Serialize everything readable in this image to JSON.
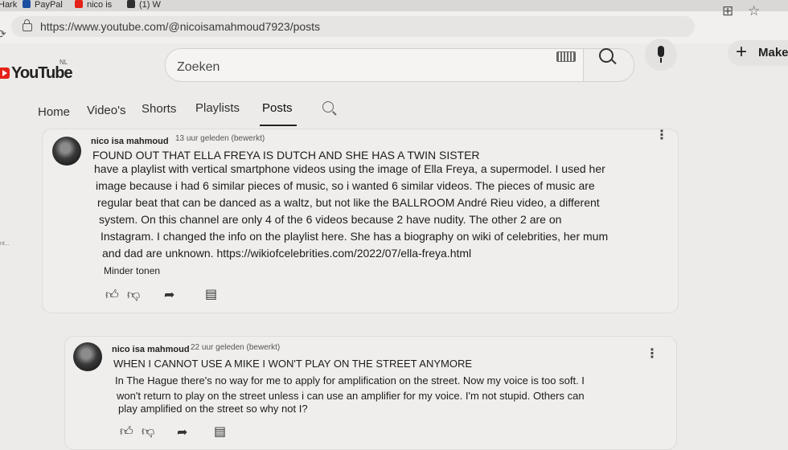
{
  "browser": {
    "tabs": [
      {
        "label": "Hark",
        "color": "#a8b4c0"
      },
      {
        "label": "PayPal",
        "color": "#1d4fa0"
      },
      {
        "label": "nico is",
        "color": "#e62117"
      },
      {
        "label": "(1) W",
        "color": "#2f2f2f"
      }
    ],
    "url": "https://www.youtube.com/@nicoisamahmoud7923/posts",
    "icons": [
      "reload-icon",
      "lock-icon",
      "collections-icon",
      "favorite-star-icon"
    ]
  },
  "youtube": {
    "logo_text": "YouTube",
    "country_code": "NL",
    "search_placeholder": "Zoeken",
    "create_label": "Maker"
  },
  "channel_tabs": [
    {
      "label": "Home",
      "active": false
    },
    {
      "label": "Video's",
      "active": false
    },
    {
      "label": "Shorts",
      "active": false
    },
    {
      "label": "Playlists",
      "active": false
    },
    {
      "label": "Posts",
      "active": true
    }
  ],
  "side_fragment": "nt...",
  "posts": [
    {
      "author": "nico isa mahmoud",
      "meta": "13 uur geleden (bewerkt)",
      "lines": [
        "FOUND OUT THAT ELLA FREYA IS DUTCH AND SHE HAS A TWIN SISTER",
        "have a playlist with vertical smartphone videos using the image of Ella Freya, a supermodel. I used her",
        "image because i had 6 similar pieces of music, so i wanted 6 similar videos. The pieces of music are",
        "regular beat that can be danced as a waltz, but not like the BALLROOM André Rieu video, a different",
        "system. On this channel are only 4 of the 6 videos because 2 have nudity. The other 2 are on",
        "Instagram. I changed the info on the playlist here. She has a biography on wiki of celebrities, her mum",
        "and dad are unknown. https://wikiofcelebrities.com/2022/07/ella-freya.html"
      ],
      "show_less": "Minder tonen"
    },
    {
      "author": "nico isa mahmoud",
      "meta": "22 uur geleden (bewerkt)",
      "lines": [
        "WHEN I CANNOT USE A MIKE I WON'T PLAY ON THE STREET ANYMORE",
        "In The Hague there's no way for me to apply for amplification on the street. Now my voice is too soft. I",
        "won't return to play on the street unless i can use an amplifier for my voice. I'm not stupid. Others can",
        "play amplified on the street so why not I?"
      ]
    }
  ],
  "colors": {
    "accent": "#e62117",
    "page_bg": "#ecebe9"
  }
}
